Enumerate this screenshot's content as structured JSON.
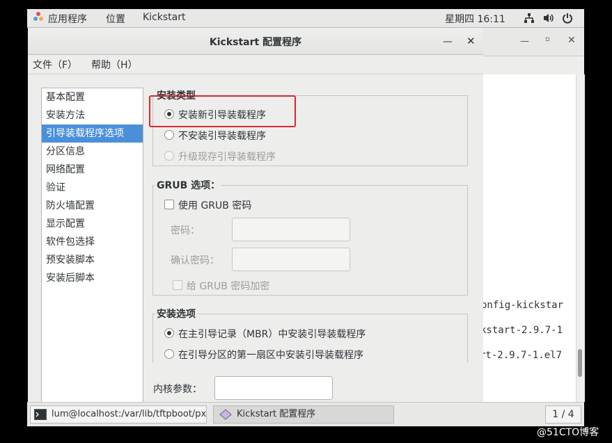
{
  "top_panel": {
    "apps_label": "应用程序",
    "places_label": "位置",
    "app_name": "Kickstart",
    "clock": "星期四 16:11"
  },
  "window": {
    "title": "Kickstart 配置程序",
    "menu": {
      "file": "文件（F）",
      "help": "帮助（H）"
    }
  },
  "sidebar": {
    "items": [
      {
        "label": "基本配置"
      },
      {
        "label": "安装方法"
      },
      {
        "label": "引导装载程序选项"
      },
      {
        "label": "分区信息"
      },
      {
        "label": "网络配置"
      },
      {
        "label": "验证"
      },
      {
        "label": "防火墙配置"
      },
      {
        "label": "显示配置"
      },
      {
        "label": "软件包选择"
      },
      {
        "label": "预安装脚本"
      },
      {
        "label": "安装后脚本"
      }
    ]
  },
  "install_type": {
    "heading": "安装类型",
    "opt_new": "安装新引导装载程序",
    "opt_none": "不安装引导装载程序",
    "opt_upgrade": "升级现存引导装载程序"
  },
  "grub": {
    "heading": "GRUB 选项：",
    "use_password": "使用  GRUB 密码",
    "password_label": "密码：",
    "confirm_label": "确认密码：",
    "encrypt_label": "给  GRUB 密码加密"
  },
  "install_options": {
    "heading": "安装选项",
    "opt_mbr": "在主引导记录（MBR）中安装引导装载程序",
    "opt_partition": "在引导分区的第一扇区中安装引导装载程序"
  },
  "kernel": {
    "label": "内核参数：",
    "value": ""
  },
  "terminal_lines": [
    "onfig-kickstar",
    "kstart-2.9.7-1",
    "rt-2.9.7-1.el7"
  ],
  "taskbar": {
    "terminal_task": "lum@localhost:/var/lib/tftpboot/px…",
    "kickstart_task": "Kickstart 配置程序",
    "pager": "1 / 4"
  },
  "watermark": "@51CTO博客",
  "colors": {
    "selection": "#4a90d9",
    "highlight_box": "#d9272e"
  }
}
